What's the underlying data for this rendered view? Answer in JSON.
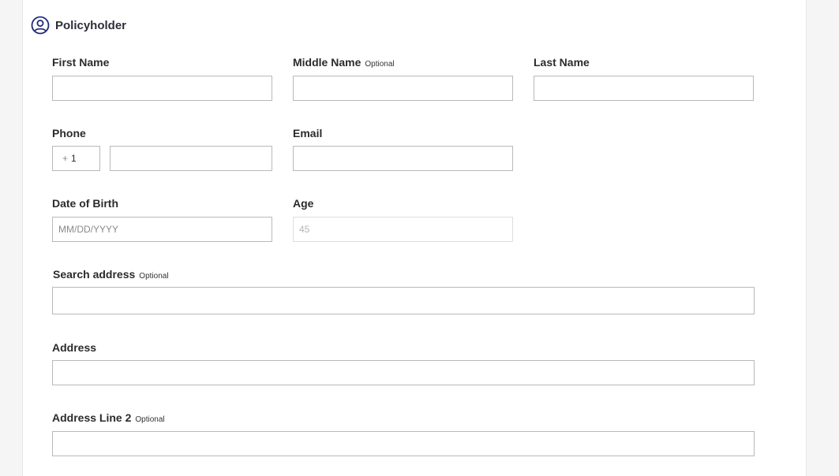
{
  "section": {
    "title": "Policyholder",
    "icon": "user-circle-icon"
  },
  "fields": {
    "first_name": {
      "label": "First Name",
      "value": ""
    },
    "middle_name": {
      "label": "Middle Name",
      "optional": "Optional",
      "value": ""
    },
    "last_name": {
      "label": "Last Name",
      "value": ""
    },
    "phone": {
      "label": "Phone",
      "country_plus": "+",
      "country_code": "1",
      "value": ""
    },
    "email": {
      "label": "Email",
      "value": ""
    },
    "dob": {
      "label": "Date of Birth",
      "placeholder": "MM/DD/YYYY"
    },
    "age": {
      "label": "Age",
      "placeholder": "45"
    },
    "search_address": {
      "label": "Search address",
      "optional": "Optional",
      "value": ""
    },
    "address": {
      "label": "Address",
      "value": ""
    },
    "address_line2": {
      "label": "Address Line 2",
      "optional": "Optional",
      "value": ""
    }
  },
  "colors": {
    "icon": "#1f2a7a",
    "border": "#b9b9b9",
    "page_bg": "#f5f5f5"
  }
}
